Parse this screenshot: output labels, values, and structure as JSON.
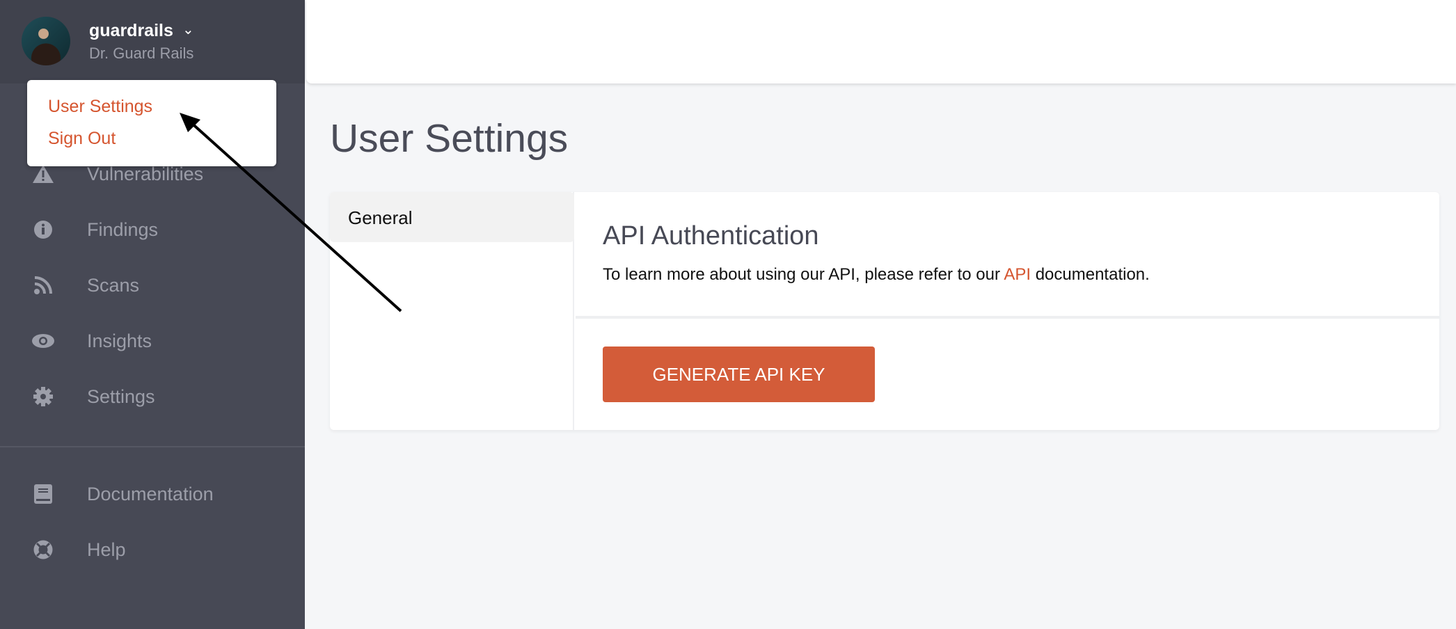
{
  "user": {
    "org": "guardrails",
    "name": "Dr. Guard Rails"
  },
  "dropdown": {
    "items": [
      {
        "label": "User Settings"
      },
      {
        "label": "Sign Out"
      }
    ]
  },
  "sidebar": {
    "items": [
      {
        "label": "Vulnerabilities",
        "icon": "warning-icon"
      },
      {
        "label": "Findings",
        "icon": "info-icon"
      },
      {
        "label": "Scans",
        "icon": "rss-icon"
      },
      {
        "label": "Insights",
        "icon": "eye-icon"
      },
      {
        "label": "Settings",
        "icon": "gear-icon"
      }
    ],
    "footer_items": [
      {
        "label": "Documentation",
        "icon": "book-icon"
      },
      {
        "label": "Help",
        "icon": "lifebuoy-icon"
      }
    ]
  },
  "page": {
    "title": "User Settings",
    "tabs": [
      {
        "label": "General",
        "active": true
      }
    ],
    "section": {
      "title": "API Authentication",
      "text_before": "To learn more about using our API, please refer to our ",
      "link": "API",
      "text_after": " documentation.",
      "button": "GENERATE API KEY"
    }
  },
  "colors": {
    "accent": "#d35c39",
    "sidebar": "#474955"
  }
}
